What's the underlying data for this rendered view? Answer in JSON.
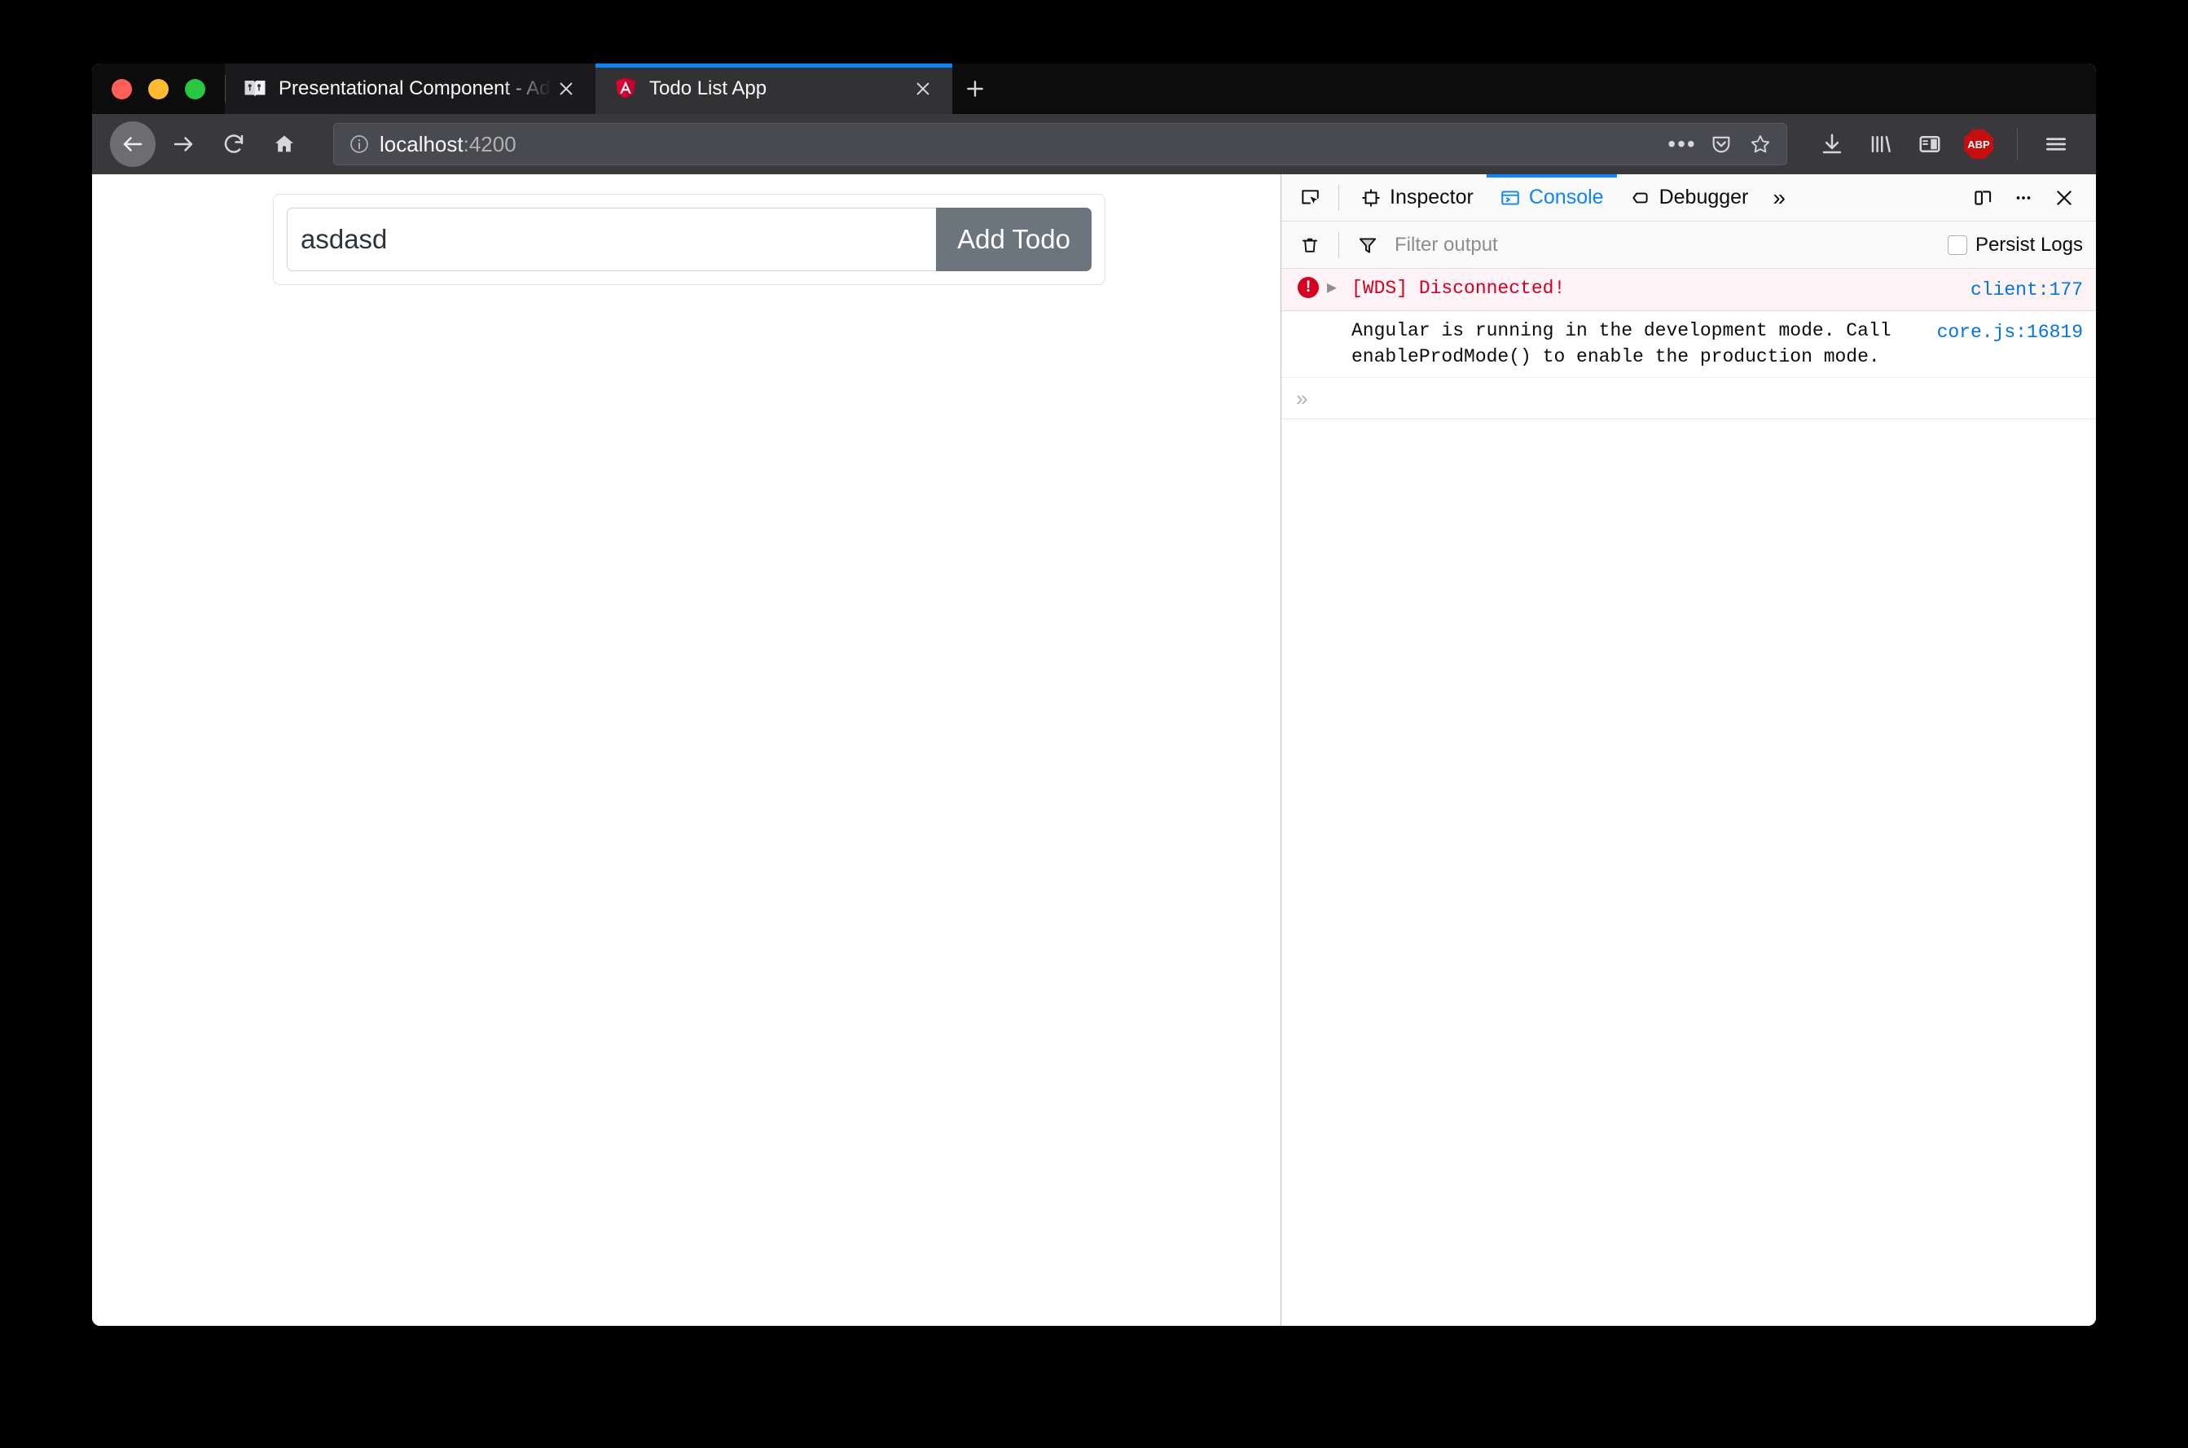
{
  "window": {
    "traffic_lights": [
      "close",
      "minimize",
      "zoom"
    ],
    "colors": {
      "tab_strip_bg": "#0c0c0d",
      "toolbar_bg": "#38383d",
      "active_tab_accent": "#0a84ff",
      "button_secondary": "#6c757d",
      "console_error": "#d70022",
      "console_link": "#0074e8"
    }
  },
  "tabs": [
    {
      "title": "Presentational Component - Ad",
      "favicon": "book-icon",
      "active": false,
      "close_label": "Close tab"
    },
    {
      "title": "Todo List App",
      "favicon": "angular-logo-icon",
      "active": true,
      "close_label": "Close tab"
    }
  ],
  "new_tab_label": "+",
  "nav": {
    "back": "back-arrow-icon",
    "forward": "forward-arrow-icon",
    "reload": "reload-icon",
    "home": "home-icon"
  },
  "urlbar": {
    "identity_icon": "info-circle-icon",
    "host": "localhost",
    "port": ":4200",
    "page_actions_icon": "ellipsis-icon",
    "pocket_icon": "pocket-icon",
    "bookmark_icon": "star-icon"
  },
  "toolbar_icons": [
    {
      "name": "downloads-icon",
      "label": "Downloads"
    },
    {
      "name": "library-icon",
      "label": "Library"
    },
    {
      "name": "sidebar-icon",
      "label": "Sidebars"
    },
    {
      "name": "adblock-plus-icon",
      "label": "ABP"
    },
    {
      "name": "hamburger-menu-icon",
      "label": "Open menu"
    }
  ],
  "page": {
    "todo_input_value": "asdasd",
    "todo_input_placeholder": "",
    "add_todo_label": "Add Todo"
  },
  "devtools": {
    "picker_icon": "element-picker-icon",
    "tabs": [
      {
        "label": "Inspector",
        "icon": "inspector-icon",
        "selected": false
      },
      {
        "label": "Console",
        "icon": "console-icon",
        "selected": true
      },
      {
        "label": "Debugger",
        "icon": "debugger-icon",
        "selected": false
      }
    ],
    "more_tabs": "»",
    "responsive_mode_icon": "responsive-design-mode-icon",
    "meatball_icon": "meatball-menu-icon",
    "close_icon": "close-icon",
    "filter_bar": {
      "clear_icon": "trash-icon",
      "filter_icon": "funnel-icon",
      "filter_placeholder": "Filter output",
      "filter_value": "",
      "persist_logs_label": "Persist Logs",
      "persist_logs_checked": false
    },
    "messages": [
      {
        "level": "error",
        "icon": "error-badge-icon",
        "expandable": true,
        "expand_icon": "triangle-right-icon",
        "text": "[WDS] Disconnected!",
        "source": "client:177"
      },
      {
        "level": "log",
        "icon": "",
        "expandable": false,
        "expand_icon": "",
        "text": "Angular is running in the development mode. Call enableProdMode() to enable the production mode.",
        "source": "core.js:16819"
      }
    ],
    "console_prompt": "»"
  }
}
